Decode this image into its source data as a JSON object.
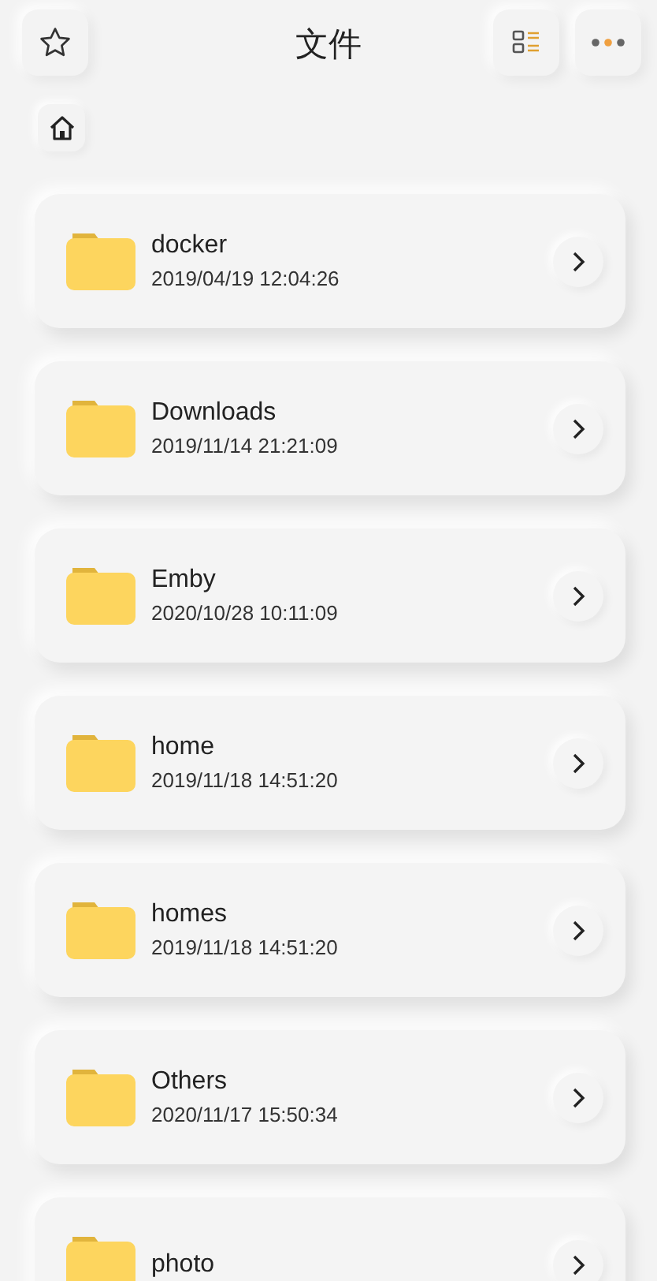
{
  "header": {
    "title": "文件"
  },
  "files": [
    {
      "name": "docker",
      "modified": "2019/04/19 12:04:26"
    },
    {
      "name": "Downloads",
      "modified": "2019/11/14 21:21:09"
    },
    {
      "name": "Emby",
      "modified": "2020/10/28 10:11:09"
    },
    {
      "name": "home",
      "modified": "2019/11/18 14:51:20"
    },
    {
      "name": "homes",
      "modified": "2019/11/18 14:51:20"
    },
    {
      "name": "Others",
      "modified": "2020/11/17 15:50:34"
    },
    {
      "name": "photo"
    }
  ]
}
